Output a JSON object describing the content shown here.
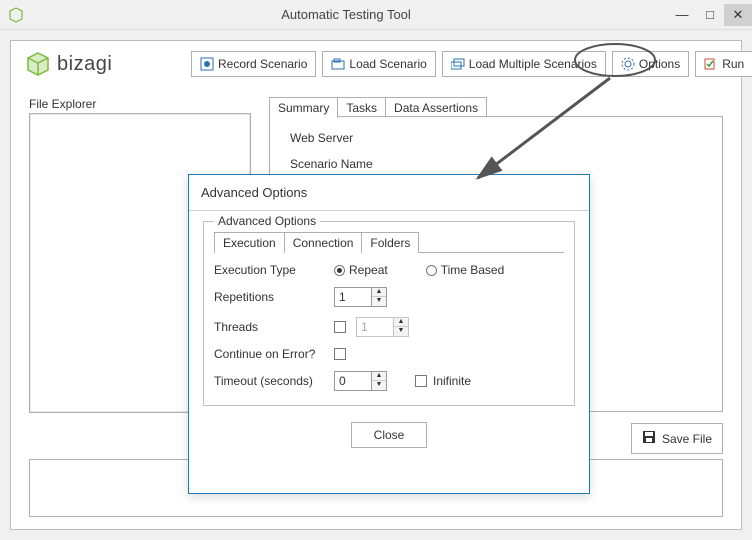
{
  "window": {
    "title": "Automatic Testing Tool",
    "min": "—",
    "max": "□",
    "close": "✕"
  },
  "brand": {
    "name": "bizagi"
  },
  "toolbar": {
    "record": "Record Scenario",
    "load": "Load Scenario",
    "loadMulti": "Load Multiple Scenarios",
    "options": "Options",
    "run": "Run"
  },
  "fileExplorer": {
    "label": "File Explorer"
  },
  "tabs": {
    "summary": "Summary",
    "tasks": "Tasks",
    "assertions": "Data Assertions"
  },
  "summaryPanel": {
    "webserver_label": "Web Server",
    "scenario_label": "Scenario Name"
  },
  "saveFile": "Save File",
  "dialog": {
    "title": "Advanced Options",
    "fieldset_legend": "Advanced Options",
    "tabs": {
      "execution": "Execution",
      "connection": "Connection",
      "folders": "Folders"
    },
    "execType_label": "Execution Type",
    "execType_repeat": "Repeat",
    "execType_timebased": "Time Based",
    "repetitions_label": "Repetitions",
    "repetitions_value": "1",
    "threads_label": "Threads",
    "threads_value": "1",
    "continue_label": "Continue on Error?",
    "timeout_label": "Timeout (seconds)",
    "timeout_value": "0",
    "infinite_label": "Inifinite",
    "close": "Close"
  }
}
